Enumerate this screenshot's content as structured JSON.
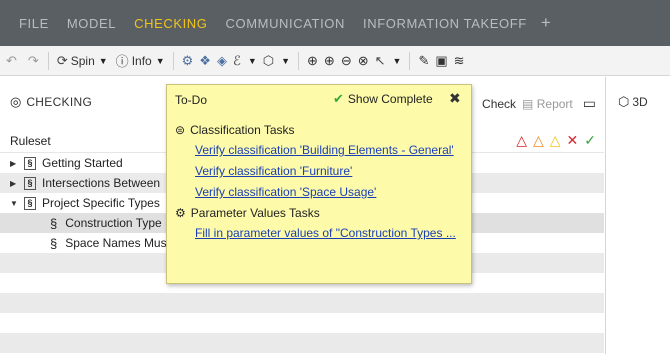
{
  "menubar": {
    "items": [
      "FILE",
      "MODEL",
      "CHECKING",
      "COMMUNICATION",
      "INFORMATION TAKEOFF"
    ],
    "active": "CHECKING",
    "add": "+"
  },
  "toolbar": {
    "spin_label": "Spin",
    "info_label": "Info"
  },
  "panel": {
    "title": "CHECKING",
    "check_label": "Check",
    "report_label": "Report",
    "ruleset_label": "Ruleset"
  },
  "rows": [
    {
      "label": "Getting Started",
      "expanded": false
    },
    {
      "label": "Intersections Between",
      "expanded": false
    },
    {
      "label": "Project Specific Types",
      "expanded": true
    },
    {
      "label": "Construction Type",
      "child": true
    },
    {
      "label": "Space Names Mus",
      "child": true
    }
  ],
  "right_panel": {
    "title": "3D"
  },
  "todo": {
    "title": "To-Do",
    "show_complete": "Show Complete",
    "section1": "Classification Tasks",
    "links1": [
      "Verify classification 'Building Elements - General'",
      "Verify classification 'Furniture'",
      "Verify classification 'Space Usage'"
    ],
    "section2": "Parameter Values Tasks",
    "links2": [
      "Fill in parameter values of \"Construction Types ..."
    ]
  },
  "colors": {
    "menubar_bg": "#5a5f64",
    "menu_active": "#f0c419",
    "popup_bg": "#fdfbaa",
    "link": "#1a3fb4",
    "severity_critical": "#d9262c",
    "severity_moderate": "#f08a24",
    "severity_low": "#f0c419",
    "ok": "#3aa53a"
  }
}
